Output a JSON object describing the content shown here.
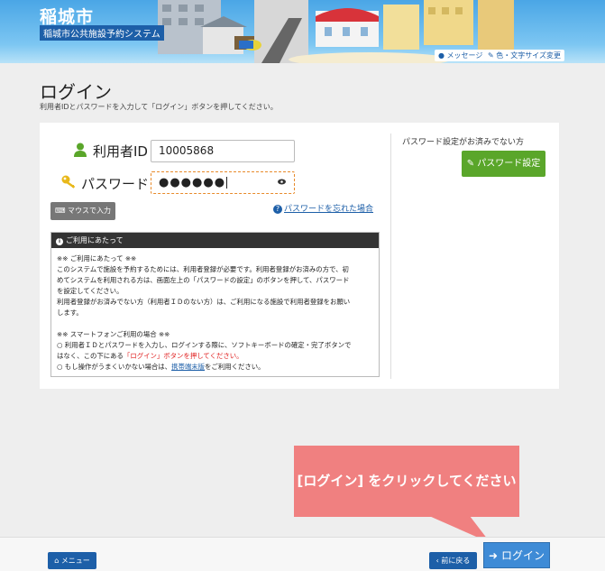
{
  "header": {
    "city_name": "稲城市",
    "system_name": "稲城市公共施設予約システム",
    "messages_link": "メッセージ",
    "text_size_link": "色・文字サイズ変更"
  },
  "page": {
    "title": "ログイン",
    "description": "利用者IDとパスワードを入力して「ログイン」ボタンを押してください。"
  },
  "form": {
    "user_id_label": "利用者ID",
    "user_id_value": "10005868",
    "password_label": "パスワード",
    "password_mask": "●●●●●●",
    "mouse_input_label": "マウスで入力",
    "forgot_password_label": "パスワードを忘れた場合"
  },
  "notice": {
    "heading": "ご利用にあたって",
    "lines": [
      "※※ ご利用にあたって ※※",
      "このシステムで施設を予約するためには、利用者登録が必要です。利用者登録がお済みの方で、初",
      "めてシステムを利用される方は、画面左上の「パスワードの設定」のボタンを押して、パスワード",
      "を設定してください。",
      "利用者登録がお済みでない方（利用者ＩＤのない方）は、ご利用になる施設で利用者登録をお願い",
      "します。",
      "",
      "※※ スマートフォンご利用の場合 ※※",
      "○ 利用者ＩＤとパスワードを入力し、ログインする際に、ソフトキーボードの確定・完了ボタンで",
      "はなく、この下にある"
    ],
    "red_text": "「ログイン」ボタンを押してください。",
    "last_line_prefix": "○ もし操作がうまくいかない場合は、",
    "mobile_link": "携帯端末版",
    "last_line_suffix": "をご利用ください。"
  },
  "password_setup": {
    "prompt": "パスワード設定がお済みでない方",
    "button_label": "パスワード設定"
  },
  "footer": {
    "menu_label": "メニュー",
    "back_label": "前に戻る",
    "login_label": "ログイン"
  },
  "callout": {
    "text": "[ログイン] をクリックしてください"
  },
  "colors": {
    "primary_blue": "#1d5fa8",
    "login_blue": "#3e8bd6",
    "green": "#5aa62a",
    "callout_pink": "#f08080",
    "focus_orange": "#e88a2a"
  }
}
